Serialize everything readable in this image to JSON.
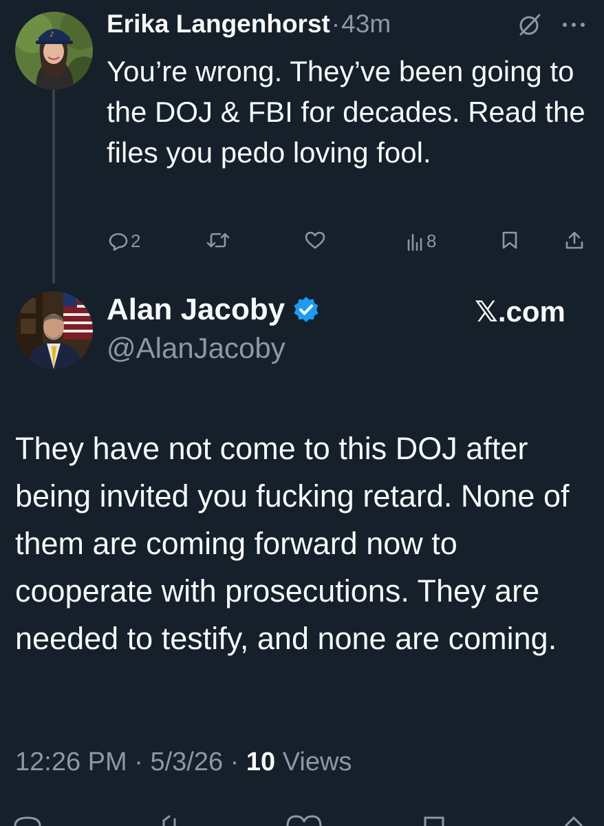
{
  "reply": {
    "author_name": "Erika Langenhorst",
    "separator": "·",
    "time": "43m",
    "text": "You’re wrong.  They’ve been going to the DOJ & FBI for decades.  Read the files you pedo loving fool.",
    "actions": {
      "replies": "2",
      "retweets": "",
      "likes": "",
      "views": "8"
    },
    "icons": [
      "grok-icon",
      "more-icon",
      "reply-icon",
      "retweet-icon",
      "like-icon",
      "views-icon",
      "bookmark-icon",
      "share-icon"
    ]
  },
  "main_tweet": {
    "author_name": "Alan Jacoby",
    "verified": true,
    "handle": "@AlanJacoby",
    "brand": "𝕏.com",
    "text": "They have not come to this DOJ after being invited you fucking retard. None of them are coming forward now to cooperate with prosecutions. They are needed to testify, and none are coming.",
    "time": "12:26 PM",
    "date": "5/3/26",
    "separator": " · ",
    "views_count": "10",
    "views_label": " Views"
  },
  "colors": {
    "background": "#15202b",
    "text_primary": "#f7f9f9",
    "text_secondary": "#8b98a5",
    "verified_badge": "#1d9bf0",
    "thread_line": "#38444d"
  }
}
